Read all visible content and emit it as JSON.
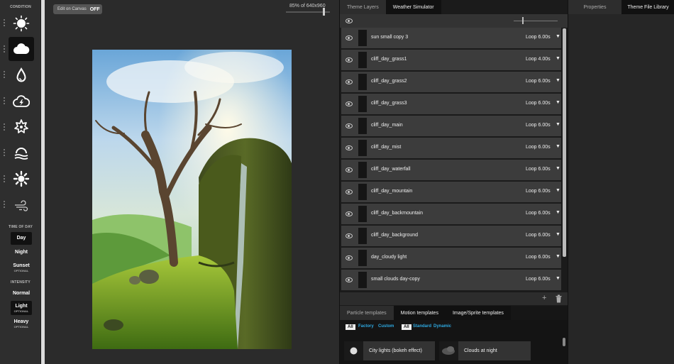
{
  "sidebar": {
    "condition_title": "CONDITION",
    "conditions": [
      {
        "icon": "sun-icon",
        "selected": false
      },
      {
        "icon": "cloud-icon",
        "selected": true
      },
      {
        "icon": "raindrop-icon",
        "selected": false
      },
      {
        "icon": "thunder-cloud-icon",
        "selected": false
      },
      {
        "icon": "snowflake-icon",
        "selected": false
      },
      {
        "icon": "fog-icon",
        "selected": false
      },
      {
        "icon": "sun-ray-icon",
        "selected": false
      },
      {
        "icon": "wind-icon",
        "selected": false
      }
    ],
    "time_title": "TIME OF DAY",
    "times": [
      {
        "label": "Day",
        "sub": "",
        "selected": true
      },
      {
        "label": "Night",
        "sub": "",
        "selected": false
      },
      {
        "label": "Sunset",
        "sub": "OPTIONAL",
        "selected": false
      }
    ],
    "intensity_title": "INTENSITY",
    "intensities": [
      {
        "label": "Normal",
        "sub": "",
        "selected": false
      },
      {
        "label": "Light",
        "sub": "OPTIONAL",
        "selected": true
      },
      {
        "label": "Heavy",
        "sub": "OPTIONAL",
        "selected": false
      }
    ]
  },
  "canvas": {
    "edit_label": "Edit on Canvas",
    "edit_state": "OFF",
    "zoom_text": "85% of 640x960",
    "zoom_level": 0.85
  },
  "layers_panel": {
    "tabs": [
      {
        "label": "Theme Layers",
        "active": false
      },
      {
        "label": "Weather Simulator",
        "active": true
      }
    ],
    "layers": [
      {
        "name": "sun small copy 3",
        "loop": "Loop 6.00s"
      },
      {
        "name": "cliff_day_grass1",
        "loop": "Loop 4.00s"
      },
      {
        "name": "cliff_day_grass2",
        "loop": "Loop 6.00s"
      },
      {
        "name": "cliff_day_grass3",
        "loop": "Loop 6.00s"
      },
      {
        "name": "cliff_day_main",
        "loop": "Loop 6.00s"
      },
      {
        "name": "cliff_day_mist",
        "loop": "Loop 6.00s"
      },
      {
        "name": "cliff_day_waterfall",
        "loop": "Loop 6.00s"
      },
      {
        "name": "cliff_day_mountain",
        "loop": "Loop 6.00s"
      },
      {
        "name": "cliff_day_backmountain",
        "loop": "Loop 6.00s"
      },
      {
        "name": "cliff_day_background",
        "loop": "Loop 6.00s"
      },
      {
        "name": "day_cloudy light",
        "loop": "Loop 6.00s"
      },
      {
        "name": "small clouds day-copy",
        "loop": "Loop 6.00s"
      }
    ],
    "add_symbol": "+"
  },
  "templates": {
    "tabs": [
      {
        "label": "Particle templates",
        "active": false
      },
      {
        "label": "Motion templates",
        "active": true
      },
      {
        "label": "Image/Sprite templates",
        "active": true
      }
    ],
    "filters_left": {
      "all": "All",
      "a": "Factory",
      "b": "Custom"
    },
    "filters_right": {
      "all": "All",
      "a": "Standard",
      "b": "Dynamic"
    },
    "cards": [
      {
        "label": "City lights (bokeh effect)"
      },
      {
        "label": "Clouds at night"
      }
    ]
  },
  "properties_panel": {
    "tabs": [
      {
        "label": "Properties",
        "active": false
      },
      {
        "label": "Theme File Library",
        "active": true
      }
    ]
  }
}
